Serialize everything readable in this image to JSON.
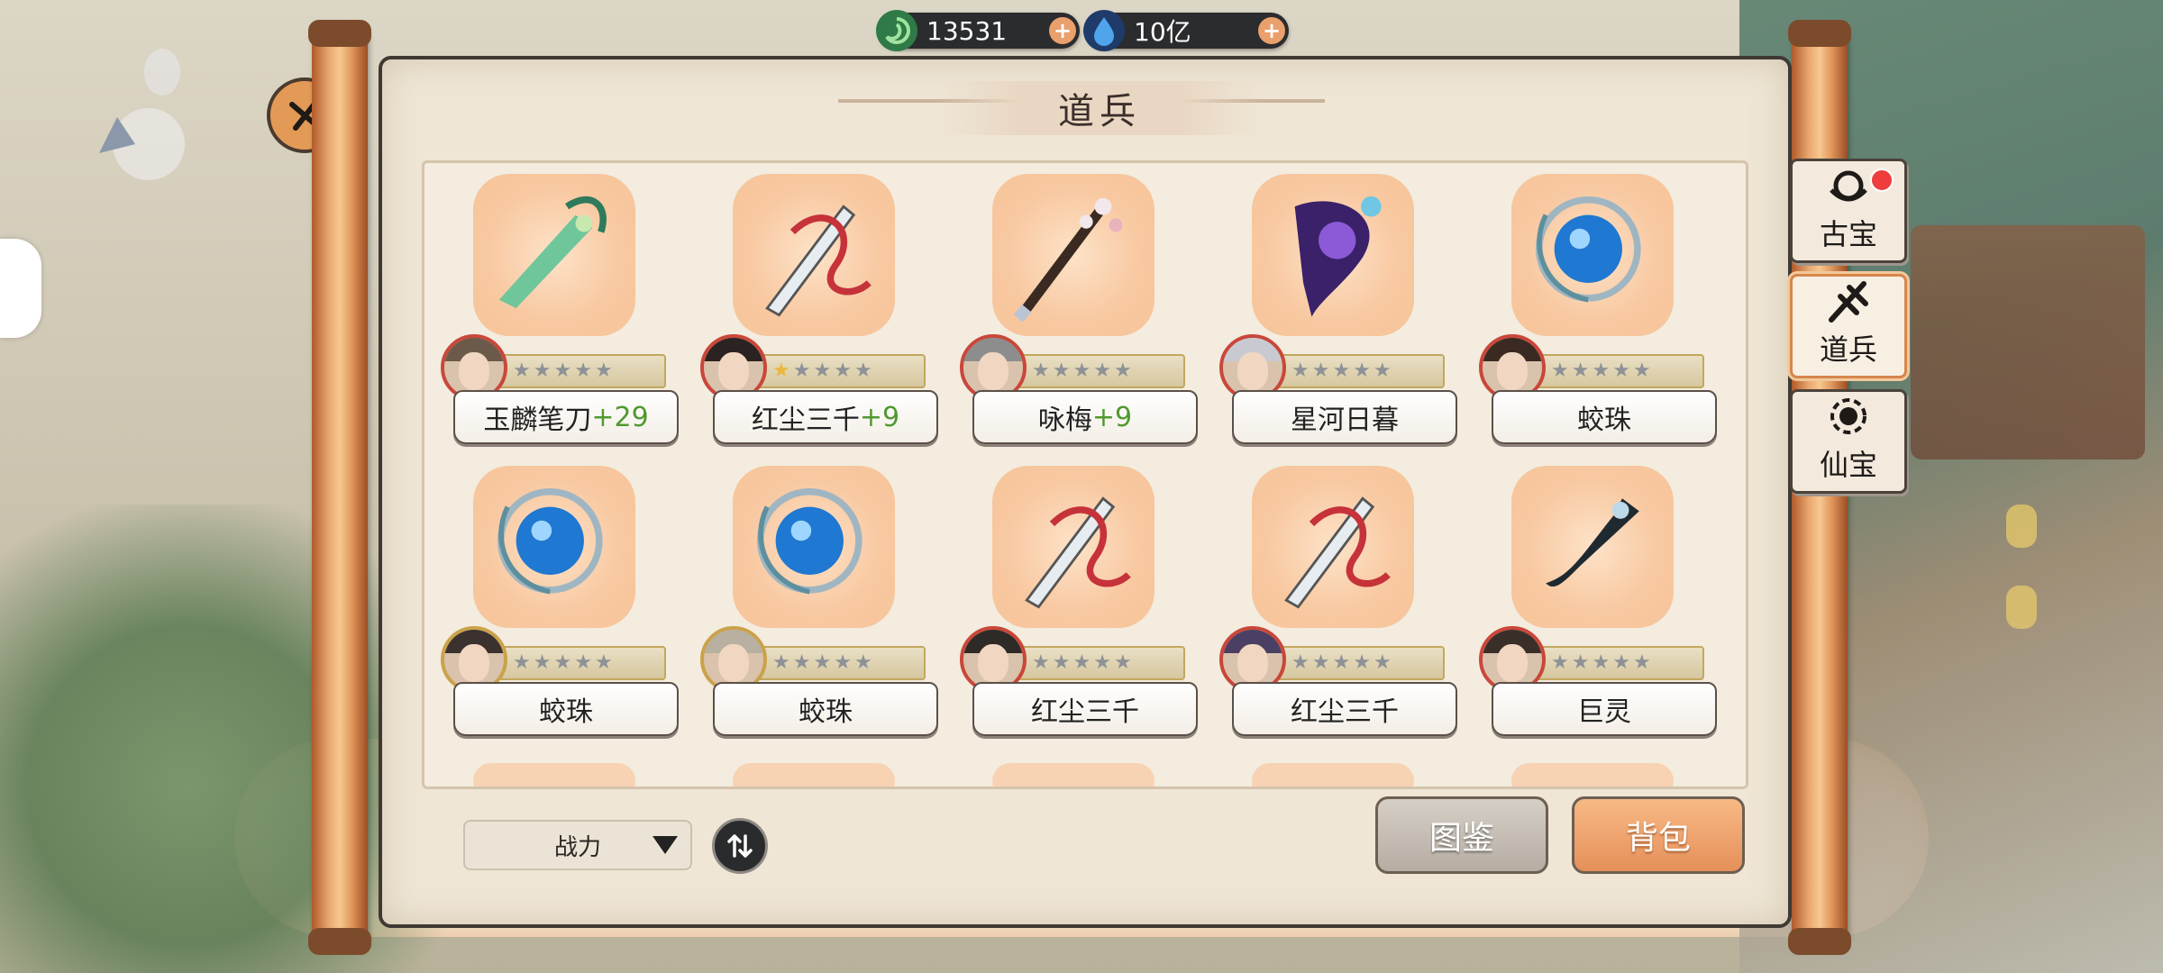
{
  "currency": {
    "jade": {
      "icon": "jade-swirl-icon",
      "value": "13531"
    },
    "crystal": {
      "icon": "blue-crystal-icon",
      "value": "10亿"
    }
  },
  "panel": {
    "title": "道兵"
  },
  "side_tabs": [
    {
      "label": "古宝",
      "icon": "ancient-treasure-icon",
      "has_red_dot": true,
      "active": false
    },
    {
      "label": "道兵",
      "icon": "daobing-weapon-icon",
      "has_red_dot": false,
      "active": true
    },
    {
      "label": "仙宝",
      "icon": "immortal-treasure-icon",
      "has_red_dot": false,
      "active": false
    }
  ],
  "items": [
    {
      "name": "玉麟笔刀",
      "level": "+29",
      "stars_lit": 0,
      "weapon": "jade-brush-blade-icon",
      "avatar_border": "red"
    },
    {
      "name": "红尘三千",
      "level": "+9",
      "stars_lit": 1,
      "weapon": "red-ribbon-blade-icon",
      "avatar_border": "red"
    },
    {
      "name": "咏梅",
      "level": "+9",
      "stars_lit": 0,
      "weapon": "plum-blossom-brush-icon",
      "avatar_border": "red"
    },
    {
      "name": "星河日暮",
      "level": "",
      "stars_lit": 0,
      "weapon": "starry-galaxy-blade-icon",
      "avatar_border": "red"
    },
    {
      "name": "蛟珠",
      "level": "",
      "stars_lit": 0,
      "weapon": "dragon-pearl-icon",
      "avatar_border": "red"
    },
    {
      "name": "蛟珠",
      "level": "",
      "stars_lit": 0,
      "weapon": "dragon-pearl-icon",
      "avatar_border": "gold"
    },
    {
      "name": "蛟珠",
      "level": "",
      "stars_lit": 0,
      "weapon": "dragon-pearl-icon",
      "avatar_border": "gold"
    },
    {
      "name": "红尘三千",
      "level": "",
      "stars_lit": 0,
      "weapon": "red-ribbon-blade-icon",
      "avatar_border": "red"
    },
    {
      "name": "红尘三千",
      "level": "",
      "stars_lit": 0,
      "weapon": "red-ribbon-blade-icon",
      "avatar_border": "red"
    },
    {
      "name": "巨灵",
      "level": "",
      "stars_lit": 0,
      "weapon": "dark-hook-blade-icon",
      "avatar_border": "red"
    }
  ],
  "controls": {
    "sort_value": "战力",
    "codex_label": "图鉴",
    "bag_label": "背包"
  },
  "colors": {
    "level_green": "#4f9a2e",
    "accent_orange": "#e6905a",
    "star_gold": "#e9b83c"
  }
}
